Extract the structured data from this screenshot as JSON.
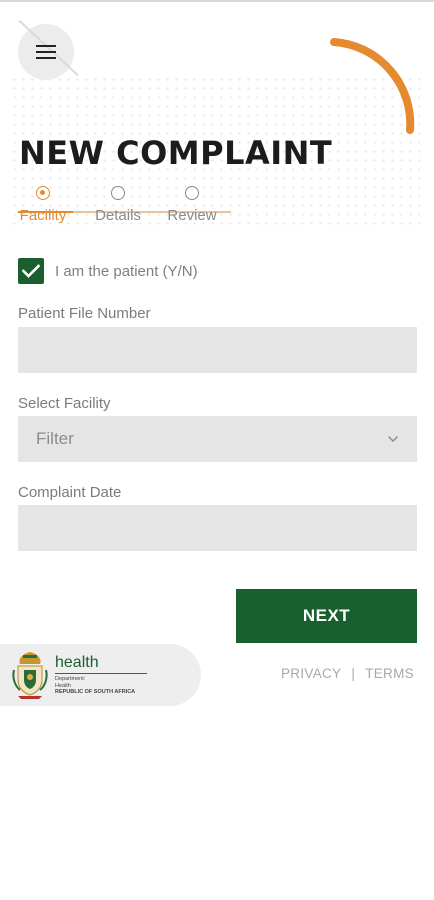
{
  "page": {
    "title": "NEW COMPLAINT"
  },
  "colors": {
    "accent": "#e58a2e",
    "primary": "#1a5f2e",
    "field_bg": "#e5e5e5"
  },
  "menu": {
    "icon": "hamburger-menu-icon"
  },
  "stepper": {
    "steps": [
      {
        "label": "Facility",
        "active": true
      },
      {
        "label": "Details",
        "active": false
      },
      {
        "label": "Review",
        "active": false
      }
    ]
  },
  "form": {
    "is_patient": {
      "label": "I am the patient (Y/N)",
      "checked": true
    },
    "patient_file_number": {
      "label": "Patient File Number",
      "value": "",
      "placeholder": ""
    },
    "facility": {
      "label": "Select Facility",
      "value": "Filter"
    },
    "complaint_date": {
      "label": "Complaint Date",
      "value": "",
      "placeholder": ""
    }
  },
  "actions": {
    "next_label": "NEXT"
  },
  "footer": {
    "logo": {
      "word": "health",
      "line1": "Department:",
      "line2": "Health",
      "line3": "REPUBLIC OF SOUTH AFRICA"
    },
    "privacy_label": "PRIVACY",
    "separator": "|",
    "terms_label": "TERMS"
  }
}
